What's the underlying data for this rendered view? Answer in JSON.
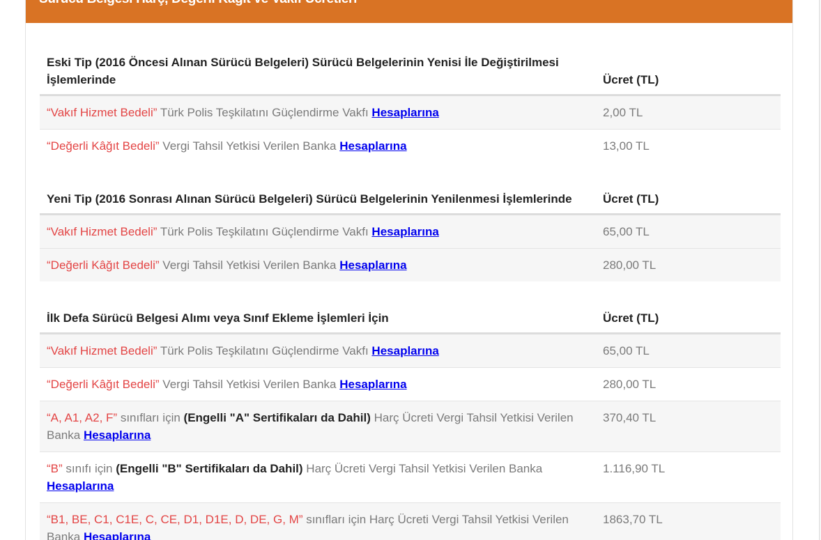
{
  "header": {
    "title": "Sürücü Belgesi Harç, Değerli Kağıt ve Vakıf Ücretleri"
  },
  "link_label": "Hesaplarına",
  "sections": [
    {
      "heading": "Eski Tip (2016 Öncesi Alınan Sürücü Belgeleri) Sürücü Belgelerinin Yenisi İle Değiştirilmesi İşlemlerinde",
      "price_header": "Ücret (TL)",
      "rows": [
        {
          "quoted": "“Vakıf Hizmet Bedeli”",
          "text": " Türk Polis Teşkilatını Güçlendirme Vakfı ",
          "price": "2,00 TL"
        },
        {
          "quoted": "“Değerli Kâğıt Bedeli”",
          "text": " Vergi Tahsil Yetkisi Verilen Banka ",
          "price": "13,00 TL"
        }
      ]
    },
    {
      "heading": "Yeni Tip (2016 Sonrası Alınan Sürücü Belgeleri) Sürücü Belgelerinin Yenilenmesi İşlemlerinde",
      "price_header": "Ücret (TL)",
      "rows": [
        {
          "quoted": "“Vakıf Hizmet Bedeli”",
          "text": " Türk Polis Teşkilatını Güçlendirme Vakfı ",
          "price": "65,00 TL"
        },
        {
          "quoted": "“Değerli Kâğıt Bedeli”",
          "text": " Vergi Tahsil Yetkisi Verilen Banka ",
          "price": "280,00 TL"
        }
      ]
    },
    {
      "heading": "İlk Defa Sürücü Belgesi Alımı veya Sınıf Ekleme İşlemleri İçin",
      "price_header": "Ücret (TL)",
      "rows": [
        {
          "quoted": "“Vakıf Hizmet Bedeli”",
          "text": " Türk Polis Teşkilatını Güçlendirme Vakfı ",
          "price": "65,00 TL"
        },
        {
          "quoted": "“Değerli Kâğıt Bedeli”",
          "text": " Vergi Tahsil Yetkisi Verilen Banka ",
          "price": "280,00 TL"
        },
        {
          "quoted": "“A, A1, A2, F”",
          "text": " sınıfları için ",
          "bold": "(Engelli \"A\" Sertifikaları da Dahil)",
          "text2": " Harç Ücreti Vergi Tahsil Yetkisi Verilen Banka ",
          "price": "370,40 TL"
        },
        {
          "quoted": "“B”",
          "text": " sınıfı için ",
          "bold": "(Engelli \"B\" Sertifikaları da Dahil)",
          "text2": " Harç Ücreti Vergi Tahsil Yetkisi Verilen Banka ",
          "price": "1.116,90 TL"
        },
        {
          "quoted": "“B1, BE, C1, C1E, C, CE, D1, D1E, D, DE, G, M”",
          "text": " sınıfları için Harç Ücreti Vergi Tahsil Yetkisi Verilen Banka ",
          "price": "1863,70 TL"
        }
      ]
    }
  ],
  "colors": {
    "header_bg": "#d97324",
    "quoted_text": "#e34444",
    "link": "#0000ee",
    "body_text": "#7a7a7a"
  }
}
